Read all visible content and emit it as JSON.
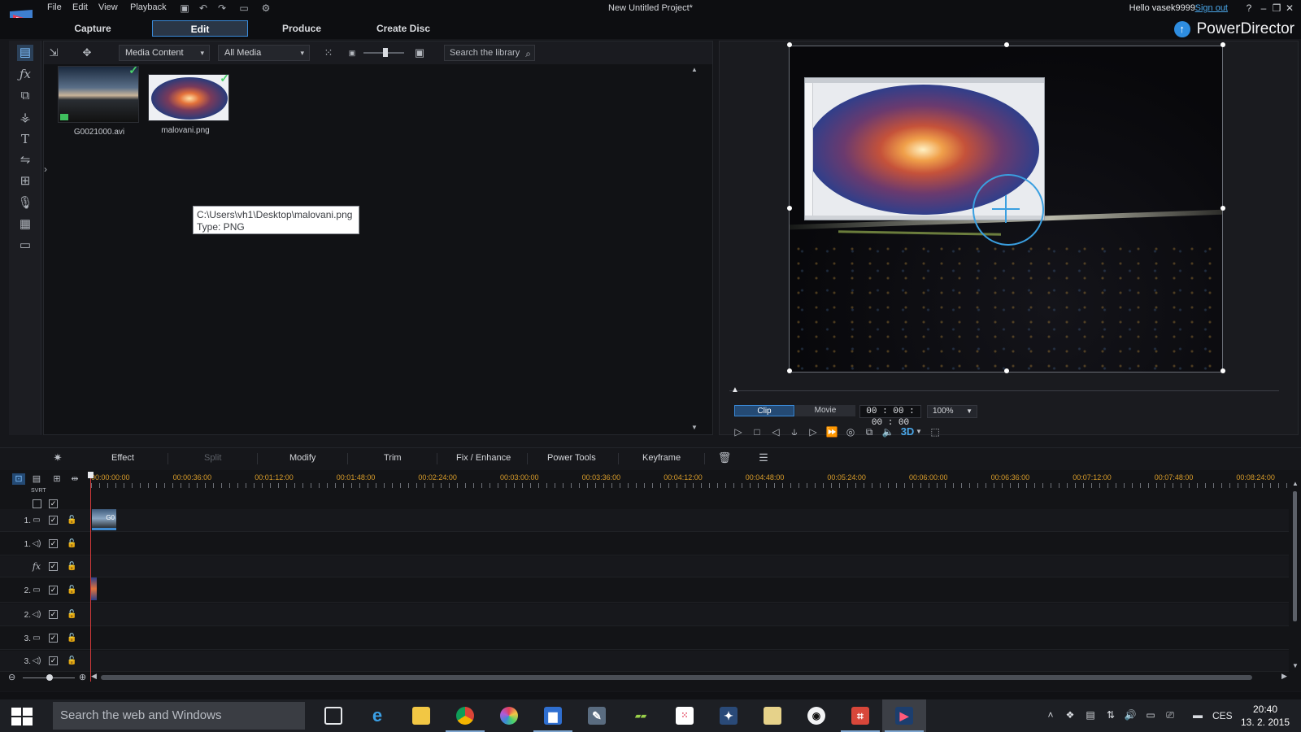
{
  "window": {
    "title": "New Untitled Project*",
    "menu": [
      "File",
      "Edit",
      "View",
      "Playback"
    ],
    "greeting": "Hello vasek9999",
    "sign_out": "Sign out",
    "help": "?"
  },
  "modes": {
    "tabs": [
      "Capture",
      "Edit",
      "Produce",
      "Create Disc"
    ],
    "active": "Edit",
    "brand": "PowerDirector"
  },
  "library": {
    "content_dropdown": "Media Content",
    "filter_dropdown": "All Media",
    "search_placeholder": "Search the library",
    "items": [
      {
        "name": "G0021000.avi",
        "type": "video",
        "in_use": true
      },
      {
        "name": "malovani.png",
        "type": "image",
        "in_use": true
      }
    ],
    "tooltip": {
      "path": "C:\\Users\\vh1\\Desktop\\malovani.png",
      "type": "Type: PNG"
    }
  },
  "preview": {
    "segments": [
      "Clip",
      "Movie"
    ],
    "active_segment": "Clip",
    "timecode": "00 : 00 : 00 : 00",
    "zoom": "100%",
    "three_d": "3D"
  },
  "edit_toolbar": {
    "buttons": [
      {
        "label": "Effect",
        "enabled": true
      },
      {
        "label": "Split",
        "enabled": false
      },
      {
        "label": "Modify",
        "enabled": true
      },
      {
        "label": "Trim",
        "enabled": true
      },
      {
        "label": "Fix / Enhance",
        "enabled": true
      },
      {
        "label": "Power Tools",
        "enabled": true
      },
      {
        "label": "Keyframe",
        "enabled": true
      }
    ]
  },
  "timeline": {
    "ruler": [
      "00:00:00:00",
      "00:00:36:00",
      "00:01:12:00",
      "00:01:48:00",
      "00:02:24:00",
      "00:03:00:00",
      "00:03:36:00",
      "00:04:12:00",
      "00:04:48:00",
      "00:05:24:00",
      "00:06:00:00",
      "00:06:36:00",
      "00:07:12:00",
      "00:07:48:00",
      "00:08:24:00"
    ],
    "svrt_label": "SVRT",
    "tracks": [
      {
        "num": "1.",
        "kind": "video"
      },
      {
        "num": "1.",
        "kind": "audio"
      },
      {
        "num": "",
        "kind": "fx"
      },
      {
        "num": "2.",
        "kind": "video"
      },
      {
        "num": "2.",
        "kind": "audio"
      },
      {
        "num": "3.",
        "kind": "video"
      },
      {
        "num": "3.",
        "kind": "audio"
      }
    ],
    "clip_label": "G0"
  },
  "taskbar": {
    "search_placeholder": "Search the web and Windows",
    "language": "CES",
    "time": "20:40",
    "date": "13. 2. 2015"
  },
  "colors": {
    "accent": "#3a8ad8",
    "ruler_text": "#d89c2a",
    "playhead": "#d23a3a",
    "check_green": "#49d36a"
  }
}
